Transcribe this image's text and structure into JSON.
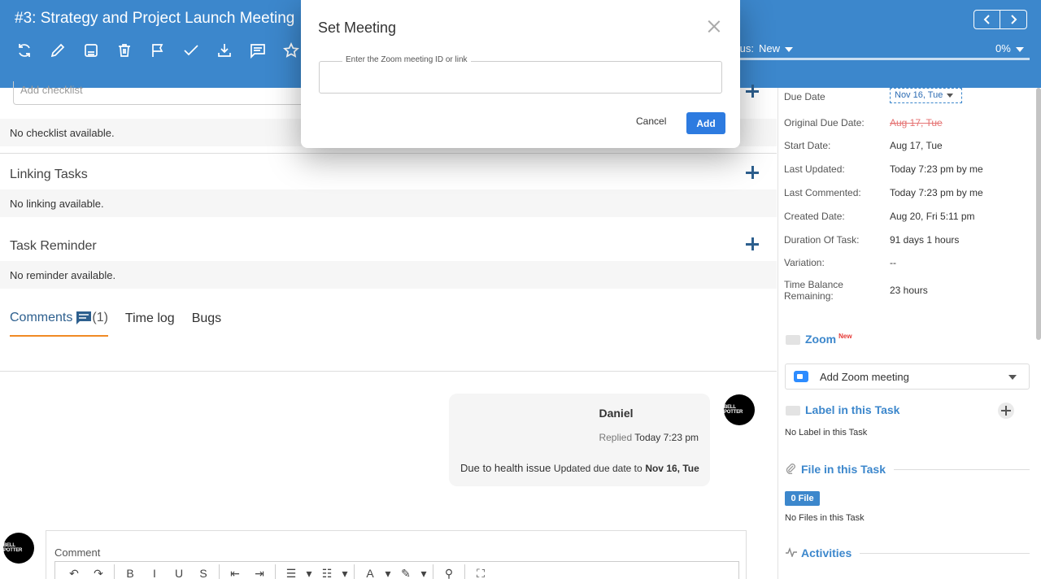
{
  "header": {
    "task_title": "#3: Strategy and Project Launch Meeting",
    "status_label": "tus:",
    "status_value": "New",
    "progress_text": "0%",
    "progress_fraction": 0,
    "toolbar_icons": [
      "refresh-icon",
      "edit-icon",
      "save-icon",
      "trash-icon",
      "flag-icon",
      "check-icon",
      "download-icon",
      "comment-icon",
      "star-icon"
    ]
  },
  "checklist": {
    "input_text": "Add checklist",
    "empty": "No checklist available."
  },
  "linking": {
    "title": "Linking Tasks",
    "empty": "No linking available."
  },
  "reminder": {
    "title": "Task Reminder",
    "empty": "No reminder available."
  },
  "tabs": {
    "comments": "Comments",
    "comments_count": "(1)",
    "timelog": "Time log",
    "bugs": "Bugs"
  },
  "comment": {
    "author": "Daniel",
    "replied_label": "Replied",
    "time": "Today 7:23 pm",
    "text": "Due to health issue",
    "update_text": "Updated due date to",
    "update_value": "Nov 16, Tue",
    "avatar_text": "BELL POTTER"
  },
  "editor": {
    "label": "Comment",
    "avatar_text": "BELL POTTER",
    "tools": [
      "↶",
      "↷",
      "|",
      "B",
      "I",
      "U",
      "S",
      "|",
      "⇤",
      "⇥",
      "|",
      "☰",
      "▾",
      "☷",
      "▾",
      "|",
      "A",
      "▾",
      "✎",
      "▾",
      "|",
      "⚲",
      "|",
      "⛶"
    ]
  },
  "details": {
    "due_date_label": "Due Date",
    "due_date_value": "Nov 16, Tue",
    "rows": [
      {
        "label": "Original Due Date:",
        "value": "Aug 17, Tue"
      },
      {
        "label": "Start Date:",
        "value": "Aug 17, Tue"
      },
      {
        "label": "Last Updated:",
        "value": "Today 7:23 pm by me"
      },
      {
        "label": "Last Commented:",
        "value": "Today 7:23 pm by me"
      },
      {
        "label": "Created Date:",
        "value": "Aug 20, Fri 5:11 pm"
      },
      {
        "label": "Duration Of Task:",
        "value": "91 days 1 hours"
      },
      {
        "label": "Variation:",
        "value": "--"
      },
      {
        "label": "Time Balance Remaining:",
        "value": "23 hours"
      }
    ]
  },
  "zoom": {
    "title": "Zoom",
    "new_tag": "New",
    "select_text": "Add Zoom meeting"
  },
  "labels": {
    "title": "Label in this Task",
    "empty": "No Label in this Task"
  },
  "files": {
    "title": "File in this Task",
    "badge": "0 File",
    "empty": "No Files in this Task"
  },
  "activities": {
    "title": "Activities"
  },
  "modal": {
    "title": "Set Meeting",
    "field_label": "Enter the Zoom meeting ID or link",
    "field_value": "",
    "cancel_label": "Cancel",
    "add_label": "Add"
  },
  "colors": {
    "header_bg": "#3c87cc",
    "accent": "#2d7be0",
    "tab_underline": "#f08a24",
    "strike": "#e57373"
  }
}
